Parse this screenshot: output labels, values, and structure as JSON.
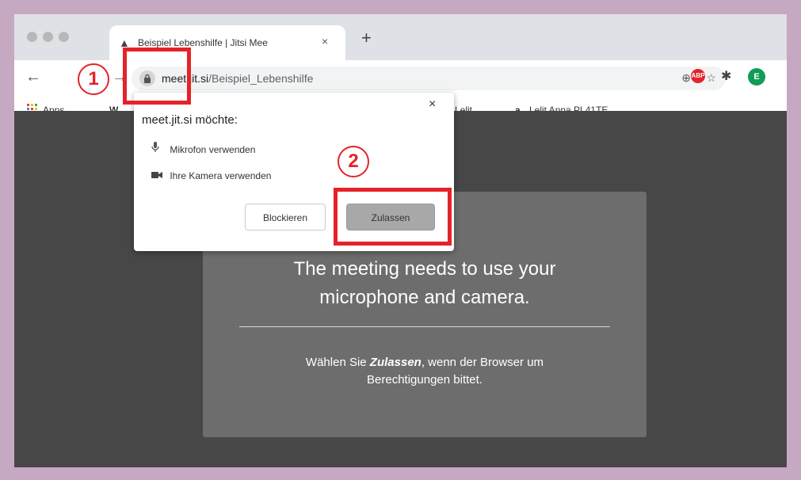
{
  "tab": {
    "title": "Beispiel Lebenshilfe | Jitsi Mee",
    "close": "×"
  },
  "new_tab": "+",
  "nav": {
    "back": "←",
    "forward": "→"
  },
  "address": {
    "domain": "meet.jit.si",
    "path": "/Beispiel_Lebenshilfe"
  },
  "bookmarks": {
    "apps": "Apps",
    "w": "W",
    "lelit": "Lelit...",
    "amazon_icon": "a",
    "lelit_anna": "Lelit Anna PL41TE..."
  },
  "extensions": {
    "abp": "ABP",
    "profile": "E"
  },
  "popup": {
    "title": "meet.jit.si möchte:",
    "close": "×",
    "permissions": [
      {
        "icon": "microphone-icon",
        "label": "Mikrofon verwenden"
      },
      {
        "icon": "camera-icon",
        "label": "Ihre Kamera verwenden"
      }
    ],
    "block_label": "Blockieren",
    "allow_label": "Zulassen"
  },
  "card": {
    "title_line1": "The meeting needs to use your",
    "title_line2": "microphone and camera.",
    "body_pre": "Wählen Sie ",
    "body_em": "Zulassen",
    "body_post": ", wenn der Browser um",
    "body_line2": "Berechtigungen bittet."
  },
  "annotations": {
    "step1": "1",
    "step2": "2"
  },
  "colors": {
    "frame": "#c7a8c2",
    "annotation": "#e52229",
    "page_bg": "#474747",
    "card_bg": "#6d6d6d"
  }
}
